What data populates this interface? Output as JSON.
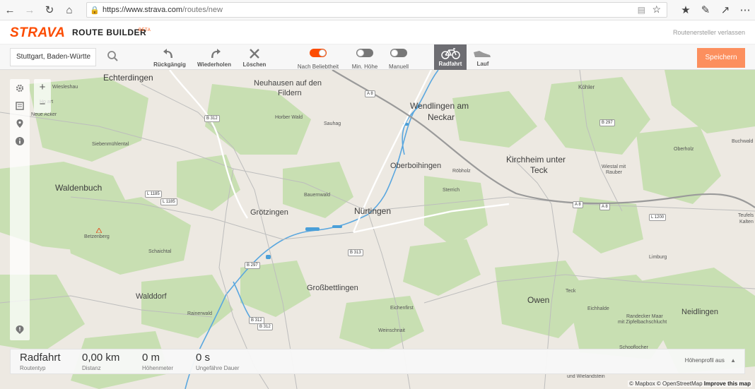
{
  "browser": {
    "url_host": "https://www.strava.com",
    "url_path": "/routes/new"
  },
  "header": {
    "logo": "STRAVA",
    "title": "ROUTE BUILDER",
    "beta": "BETA",
    "exit_label": "Routenersteller verlassen"
  },
  "toolbar": {
    "search_value": "Stuttgart, Baden-Württe",
    "undo_label": "Rückgängig",
    "redo_label": "Wiederholen",
    "clear_label": "Löschen",
    "toggles": [
      {
        "label": "Nach Beliebtheit",
        "on": true
      },
      {
        "label": "Min. Höhe",
        "on": false
      },
      {
        "label": "Manuell",
        "on": false
      }
    ],
    "sports": [
      {
        "label": "Radfahrt",
        "active": true
      },
      {
        "label": "Lauf",
        "active": false
      }
    ],
    "save_label": "Speichern"
  },
  "map": {
    "places": {
      "echterdingen": "Echterdingen",
      "neuhausen": "Neuhausen auf den",
      "neuhausen2": "Fildern",
      "wendlingen": "Wendlingen am",
      "wendlingen2": "Neckar",
      "koehler": "Köhler",
      "oberboihingen": "Oberboihingen",
      "kirchheim": "Kirchheim unter",
      "kirchheim2": "Teck",
      "waldenbuch": "Waldenbuch",
      "groetzingen": "Grötzingen",
      "nuertingen": "Nürtingen",
      "grossbettlingen": "Großbettlingen",
      "walddorf": "Walddorf",
      "owen": "Owen",
      "neidlingen": "Neidlingen",
      "wiesleshau": "Wiesleshau",
      "hofart": "Ho   art",
      "neuacker": "Neue Acker",
      "siebenmuehlental": "Siebenmühlental",
      "betzenberg": "Betzenberg",
      "schaichtal": "Schaichtal",
      "rainerwald": "Rainerwald",
      "horberwald": "Horber Wald",
      "sauhag": "Sauhag",
      "bauernwald": "Bauernwald",
      "roebholz": "Röbholz",
      "sterrich": "Sterrich",
      "eichenfirst": "Eichenfirst",
      "weinschnait": "Weinschnait",
      "wiestal": "Wiestal mit",
      "wiestal2": "Rauber",
      "oberholz": "Oberholz",
      "buchwald": "Buchwald",
      "teufels": "Teufels",
      "kalten": "Kalten",
      "limburg": "Limburg",
      "teck": "Teck",
      "eichhalde": "Eichhalde",
      "randecker": "Randecker Maar",
      "randecker2": "mit Zipfelbachschlucht",
      "wielandstein": "und Wielandstein",
      "schopfloch": "Schopflocher"
    },
    "shields": {
      "a8a": "A 8",
      "b312a": "B 312",
      "b297a": "B 297",
      "l1185a": "L 1185",
      "l1185b": "L 1185",
      "b313": "B 313",
      "b297b": "B 297",
      "b312b": "B 312",
      "b312c": "B 312",
      "a8b": "A 8",
      "a8c": "A 8",
      "l1200": "L 1200"
    },
    "colors": {
      "land": "#ede9e2",
      "forest": "#c6dfb0",
      "water": "#4a9fd8",
      "highway": "#9a9a9a",
      "accent": "#fc4c02"
    }
  },
  "stats": [
    {
      "value": "Radfahrt",
      "label": "Routentyp"
    },
    {
      "value": "0,00 km",
      "label": "Distanz"
    },
    {
      "value": "0 m",
      "label": "Höhenmeter"
    },
    {
      "value": "0 s",
      "label": "Ungefähre Dauer"
    }
  ],
  "elevation_toggle": "Höhenprofil aus",
  "attribution": {
    "mapbox": "© Mapbox",
    "osm": "© OpenStreetMap",
    "improve": "Improve this map"
  }
}
